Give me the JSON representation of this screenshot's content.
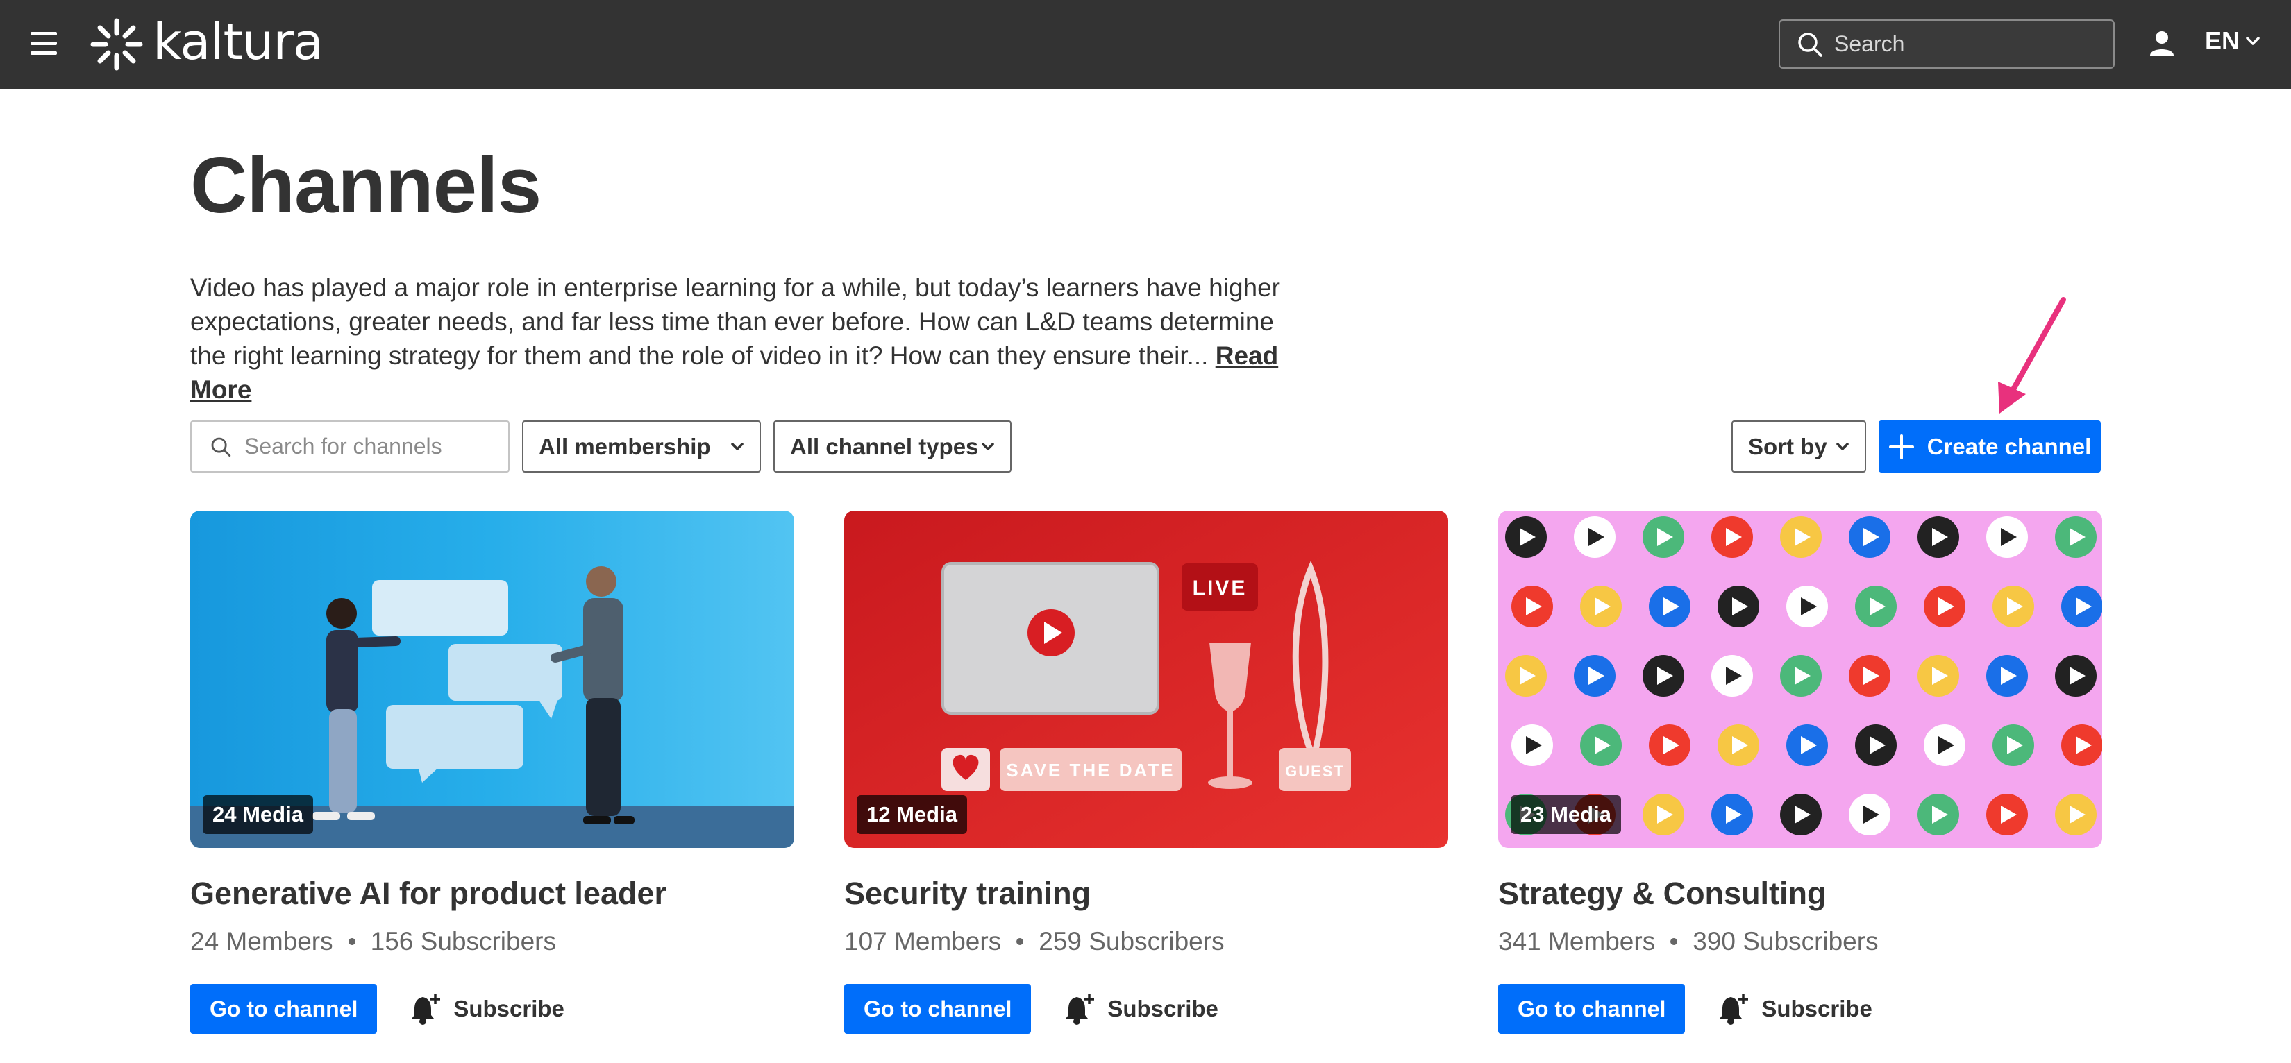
{
  "header": {
    "brand": "kaltura",
    "search_placeholder": "Search",
    "language": "EN"
  },
  "page": {
    "title": "Channels",
    "description": "Video has played a major role in enterprise learning for a while, but today’s learners have higher expectations, greater needs, and far less time than ever before. How can L&D teams determine the right learning strategy for them and the role of video in it? How can they ensure their...",
    "read_more": "Read More"
  },
  "filters": {
    "search_placeholder": "Search for channels",
    "membership": "All membership",
    "channel_types": "All channel types",
    "sort_by": "Sort by",
    "create_channel": "Create channel"
  },
  "channels": [
    {
      "title": "Generative AI for product leader",
      "media": "24 Media",
      "members": "24 Members",
      "subscribers": "156 Subscribers",
      "go_label": "Go to channel",
      "subscribe_label": "Subscribe"
    },
    {
      "title": "Security training",
      "media": "12 Media",
      "members": "107 Members",
      "subscribers": "259 Subscribers",
      "go_label": "Go to channel",
      "subscribe_label": "Subscribe"
    },
    {
      "title": "Strategy & Consulting",
      "media": "23 Media",
      "members": "341 Members",
      "subscribers": "390 Subscribers",
      "go_label": "Go to channel",
      "subscribe_label": "Subscribe"
    }
  ],
  "thumbnails": {
    "card2_live": "LIVE",
    "card2_save": "SAVE THE DATE",
    "card2_guest": "GUEST"
  },
  "icons": {
    "menu": "hamburger-menu-icon",
    "search": "search-icon",
    "user": "user-icon",
    "chevron": "chevron-down-icon",
    "plus": "plus-icon",
    "bell": "bell-plus-icon",
    "arrow": "annotation-arrow-icon"
  },
  "colors": {
    "topbar": "#333333",
    "primary": "#006efa",
    "annotation": "#e8317d"
  }
}
